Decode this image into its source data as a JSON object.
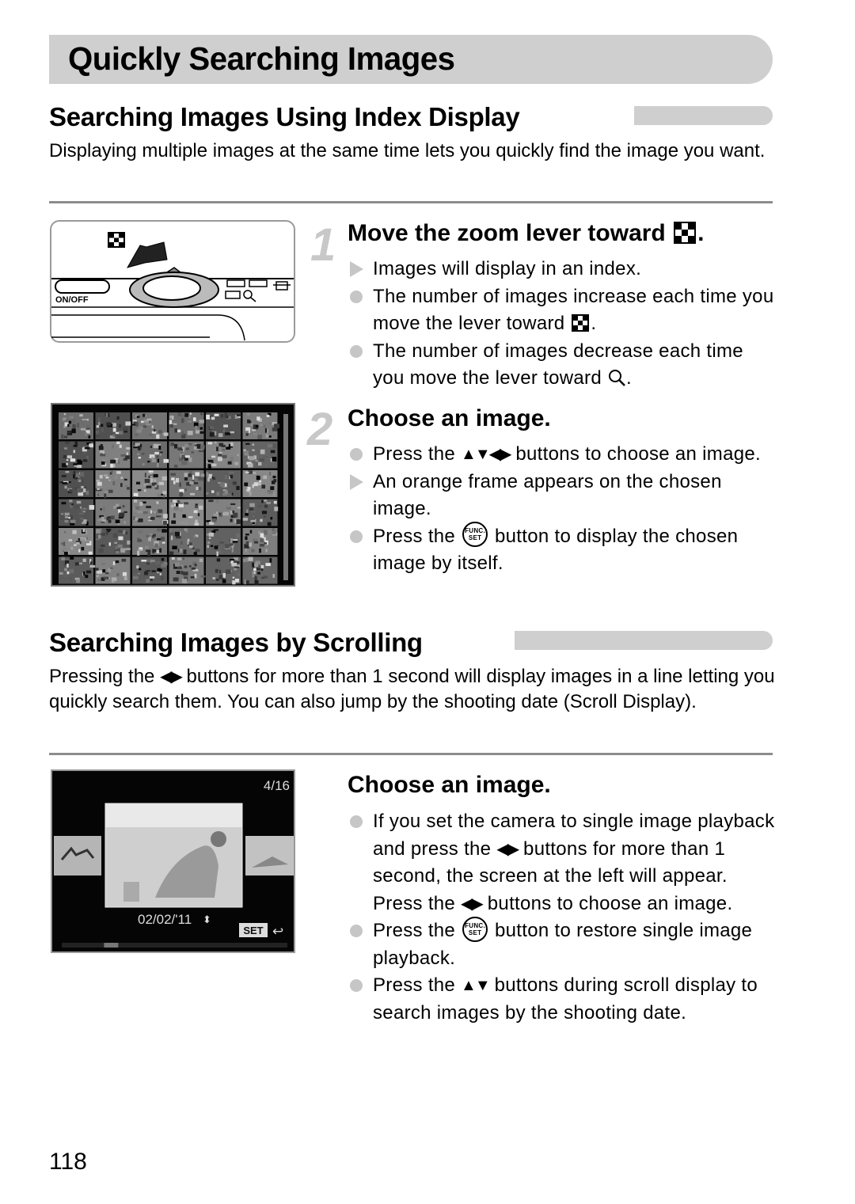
{
  "page": {
    "title": "Quickly Searching Images",
    "page_number": "118"
  },
  "sections": [
    {
      "heading": "Searching Images Using Index Display",
      "intro": "Displaying multiple images at the same time lets you quickly find the image you want.",
      "steps": [
        {
          "number": "1",
          "title_prefix": "Move the zoom lever toward ",
          "title_icon": "index-display-icon",
          "title_suffix": ".",
          "items": [
            {
              "marker": "triangle",
              "parts": [
                {
                  "text": "Images will display in an index."
                }
              ]
            },
            {
              "marker": "dot",
              "parts": [
                {
                  "text": "The number of images increase each time you move the lever toward "
                },
                {
                  "icon": "index-display-icon"
                },
                {
                  "text": "."
                }
              ]
            },
            {
              "marker": "dot",
              "parts": [
                {
                  "text": "The number of images decrease each time you move the lever toward "
                },
                {
                  "icon": "magnify-icon"
                },
                {
                  "text": "."
                }
              ]
            }
          ]
        },
        {
          "number": "2",
          "title": "Choose an image.",
          "items": [
            {
              "marker": "dot",
              "parts": [
                {
                  "text": "Press the "
                },
                {
                  "icon": "up-down-left-right-arrows-icon"
                },
                {
                  "text": " buttons to choose an image."
                }
              ]
            },
            {
              "marker": "triangle",
              "parts": [
                {
                  "text": "An orange frame appears on the chosen image."
                }
              ]
            },
            {
              "marker": "dot",
              "parts": [
                {
                  "text": "Press the "
                },
                {
                  "icon": "func-set-button-icon"
                },
                {
                  "text": " button to display the chosen image by itself."
                }
              ]
            }
          ]
        }
      ]
    },
    {
      "heading": "Searching Images by Scrolling",
      "intro_parts": [
        {
          "text": "Pressing the "
        },
        {
          "icon": "left-right-arrows-icon"
        },
        {
          "text": " buttons for more than 1 second will display images in a line letting you quickly search them. You can also jump by the shooting date (Scroll Display)."
        }
      ],
      "steps": [
        {
          "title": "Choose an image.",
          "items": [
            {
              "marker": "dot",
              "parts": [
                {
                  "text": "If you set the camera to single image playback and press the "
                },
                {
                  "icon": "left-right-arrows-icon"
                },
                {
                  "text": " buttons for more than 1 second, the screen at the left will appear. Press the "
                },
                {
                  "icon": "left-right-arrows-icon"
                },
                {
                  "text": " buttons to choose an image."
                }
              ]
            },
            {
              "marker": "dot",
              "parts": [
                {
                  "text": "Press the "
                },
                {
                  "icon": "func-set-button-icon"
                },
                {
                  "text": " button to restore single image playback."
                }
              ]
            },
            {
              "marker": "dot",
              "parts": [
                {
                  "text": "Press the "
                },
                {
                  "icon": "up-down-arrows-icon"
                },
                {
                  "text": " buttons during scroll display to search images by the shooting date."
                }
              ]
            }
          ]
        }
      ]
    }
  ],
  "illustrations": {
    "lever": {
      "power_label": "ON/OFF"
    },
    "index_screen": {
      "grid_rows": 6,
      "grid_cols": 6
    },
    "scroll_screen": {
      "counter": "4/16",
      "date": "02/02/'11",
      "set_label": "SET",
      "scroll_position": 0.2
    }
  },
  "icons": {
    "up_down_left_right": "▲▼◀▶",
    "left_right": "◀▶",
    "up_down": "▲▼",
    "func_top": "FUNC.",
    "func_bottom": "SET",
    "date_updown": "⬍",
    "return": "↩"
  },
  "colors": {
    "heading_bar": "#cfcfcf",
    "bullet_marker": "#c6c6c6",
    "step_number": "#c8c8c8",
    "divider": "#8c8c8c"
  }
}
